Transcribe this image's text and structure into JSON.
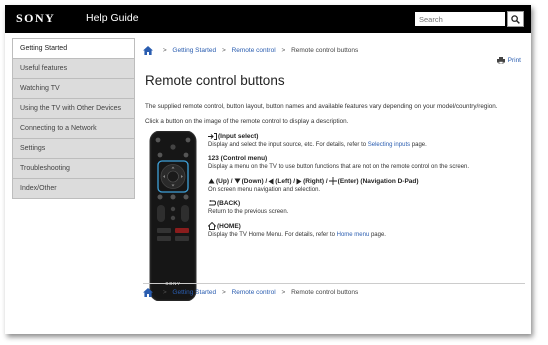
{
  "header": {
    "logo": "SONY",
    "title": "Help Guide",
    "search_placeholder": "Search"
  },
  "sidebar": {
    "items": [
      {
        "label": "Getting Started"
      },
      {
        "label": "Useful features"
      },
      {
        "label": "Watching TV"
      },
      {
        "label": "Using the TV with Other Devices"
      },
      {
        "label": "Connecting to a Network"
      },
      {
        "label": "Settings"
      },
      {
        "label": "Troubleshooting"
      },
      {
        "label": "Index/Other"
      }
    ]
  },
  "breadcrumb": {
    "items": [
      "Getting Started",
      "Remote control",
      "Remote control buttons"
    ],
    "separator": ">"
  },
  "print_label": "Print",
  "page_title": "Remote control buttons",
  "intro": "The supplied remote control, button layout, button names and available features vary depending on your model/country/region.",
  "instruction": "Click a button on the image of the remote control to display a description.",
  "remote_brand": "SONY",
  "buttons": [
    {
      "name": "(Input select)",
      "desc": "Display and select the input source, etc. For details, refer to ",
      "link": "Selecting inputs",
      "desc_after": " page."
    },
    {
      "name": "123 (Control menu)",
      "desc": "Display a menu on the TV to use button functions that are not on the remote control on the screen."
    },
    {
      "name": "(Up) / ",
      "name2": "(Down) / ",
      "name3": "(Left) / ",
      "name4": "(Right) / ",
      "name5": "(Enter) (Navigation D-Pad)",
      "desc": "On screen menu navigation and selection."
    },
    {
      "name": "(BACK)",
      "desc": "Return to the previous screen."
    },
    {
      "name": "(HOME)",
      "desc": "Display the TV Home Menu. For details, refer to ",
      "link": "Home menu",
      "desc_after": " page."
    }
  ],
  "colors": {
    "accent": "#2a5db0",
    "header_bg": "#000000",
    "sidebar_bg": "#dcdcdc",
    "highlight": "#3fa0d8"
  }
}
